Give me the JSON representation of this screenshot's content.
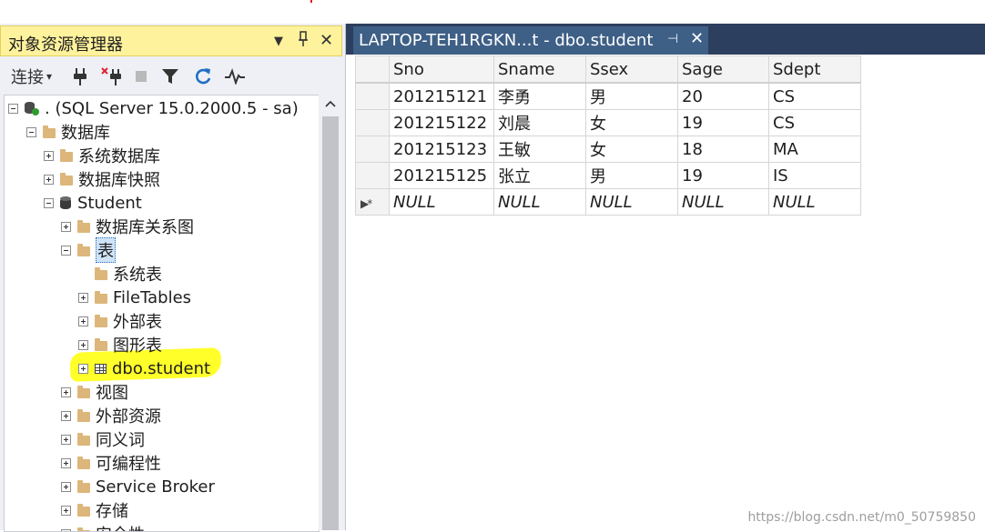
{
  "object_explorer": {
    "title": "对象资源管理器",
    "title_controls": {
      "menu": "▼",
      "pin": "ᛙ",
      "close": "✕"
    },
    "toolbar": {
      "connect_label": "连接",
      "connect_caret": "▾"
    },
    "tree": {
      "server": "(SQL Server 15.0.2000.5 - sa)",
      "server_prefix": ".",
      "databases": "数据库",
      "system_databases": "系统数据库",
      "snapshots": "数据库快照",
      "student_db": "Student",
      "diagrams": "数据库关系图",
      "tables": "表",
      "system_tables": "系统表",
      "file_tables": "FileTables",
      "external_tables": "外部表",
      "graph_tables": "图形表",
      "dbo_student": "dbo.student",
      "views": "视图",
      "external_resources": "外部资源",
      "synonyms": "同义词",
      "programmability": "可编程性",
      "service_broker": "Service Broker",
      "storage": "存储",
      "security": "安全性"
    }
  },
  "document": {
    "tab_title": "LAPTOP-TEH1RGKN...t - dbo.student",
    "tab_pin": "⊣",
    "tab_close": "✕",
    "columns": [
      "Sno",
      "Sname",
      "Ssex",
      "Sage",
      "Sdept"
    ],
    "rows": [
      [
        "201215121",
        "李勇",
        "男",
        "20",
        "CS"
      ],
      [
        "201215122",
        "刘晨",
        "女",
        "19",
        "CS"
      ],
      [
        "201215123",
        "王敏",
        "女",
        "18",
        "MA"
      ],
      [
        "201215125",
        "张立",
        "男",
        "19",
        "IS"
      ]
    ],
    "new_row_marker": "▶*",
    "null_text": "NULL"
  },
  "watermark": "https://blog.csdn.net/m0_50759850"
}
